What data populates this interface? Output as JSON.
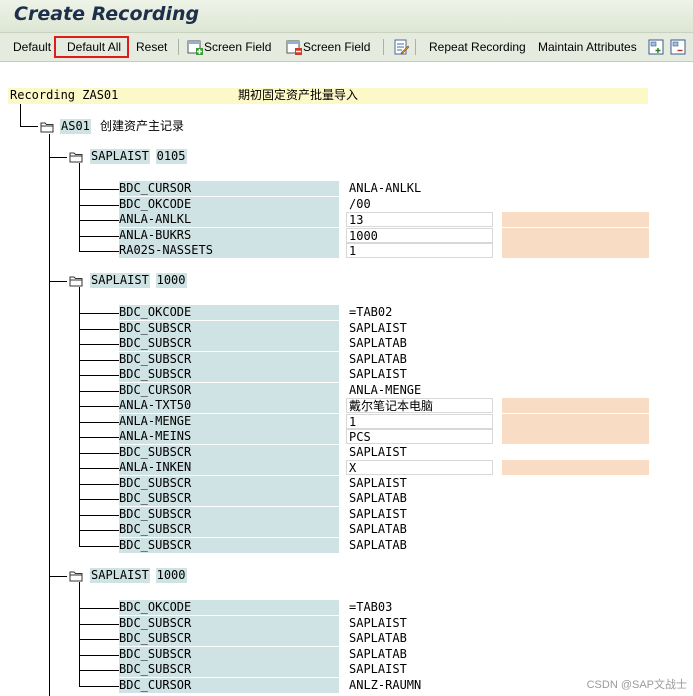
{
  "window": {
    "title": "Create Recording"
  },
  "toolbar": {
    "default": "Default",
    "default_all": "Default All",
    "reset": "Reset",
    "screen_field_1": "Screen Field",
    "screen_field_2": "Screen Field",
    "repeat_recording": "Repeat Recording",
    "maintain_attributes": "Maintain Attributes",
    "icons": [
      "screen-field-insert-icon",
      "screen-field-delete-icon",
      "edit-document-icon",
      "expand-all-icon",
      "collapse-all-icon"
    ]
  },
  "recording": {
    "label": "Recording ZAS01",
    "description": "期初固定资产批量导入"
  },
  "transaction": {
    "code": "AS01",
    "description": "创建资产主记录"
  },
  "screens": [
    {
      "program": "SAPLAIST",
      "dynpro": "0105",
      "fields": [
        {
          "name": "BDC_CURSOR",
          "value": "ANLA-ANLKL",
          "input": false
        },
        {
          "name": "BDC_OKCODE",
          "value": "/00",
          "input": false
        },
        {
          "name": "ANLA-ANLKL",
          "value": "13",
          "input": true
        },
        {
          "name": "ANLA-BUKRS",
          "value": "1000",
          "input": true
        },
        {
          "name": "RA02S-NASSETS",
          "value": "1",
          "input": true
        }
      ]
    },
    {
      "program": "SAPLAIST",
      "dynpro": "1000",
      "fields": [
        {
          "name": "BDC_OKCODE",
          "value": "=TAB02",
          "input": false
        },
        {
          "name": "BDC_SUBSCR",
          "value": "SAPLAIST",
          "input": false
        },
        {
          "name": "BDC_SUBSCR",
          "value": "SAPLATAB",
          "input": false
        },
        {
          "name": "BDC_SUBSCR",
          "value": "SAPLATAB",
          "input": false
        },
        {
          "name": "BDC_SUBSCR",
          "value": "SAPLAIST",
          "input": false
        },
        {
          "name": "BDC_CURSOR",
          "value": "ANLA-MENGE",
          "input": false
        },
        {
          "name": "ANLA-TXT50",
          "value": "戴尔笔记本电脑",
          "input": true
        },
        {
          "name": "ANLA-MENGE",
          "value": "1",
          "input": true
        },
        {
          "name": "ANLA-MEINS",
          "value": "PCS",
          "input": true
        },
        {
          "name": "BDC_SUBSCR",
          "value": "SAPLAIST",
          "input": false
        },
        {
          "name": "ANLA-INKEN",
          "value": "X",
          "input": true
        },
        {
          "name": "BDC_SUBSCR",
          "value": "SAPLAIST",
          "input": false
        },
        {
          "name": "BDC_SUBSCR",
          "value": "SAPLATAB",
          "input": false
        },
        {
          "name": "BDC_SUBSCR",
          "value": "SAPLAIST",
          "input": false
        },
        {
          "name": "BDC_SUBSCR",
          "value": "SAPLATAB",
          "input": false
        },
        {
          "name": "BDC_SUBSCR",
          "value": "SAPLATAB",
          "input": false
        }
      ]
    },
    {
      "program": "SAPLAIST",
      "dynpro": "1000",
      "fields": [
        {
          "name": "BDC_OKCODE",
          "value": "=TAB03",
          "input": false
        },
        {
          "name": "BDC_SUBSCR",
          "value": "SAPLAIST",
          "input": false
        },
        {
          "name": "BDC_SUBSCR",
          "value": "SAPLATAB",
          "input": false
        },
        {
          "name": "BDC_SUBSCR",
          "value": "SAPLATAB",
          "input": false
        },
        {
          "name": "BDC_SUBSCR",
          "value": "SAPLAIST",
          "input": false
        },
        {
          "name": "BDC_CURSOR",
          "value": "ANLZ-RAUMN",
          "input": false
        }
      ]
    }
  ],
  "watermark": "CSDN @SAP文战士",
  "colors": {
    "highlight_border": "#e01b1b",
    "field_bg": "#cfe2e4",
    "recording_bg": "#fdf8c8",
    "input_pad": "#f8dcc4"
  }
}
